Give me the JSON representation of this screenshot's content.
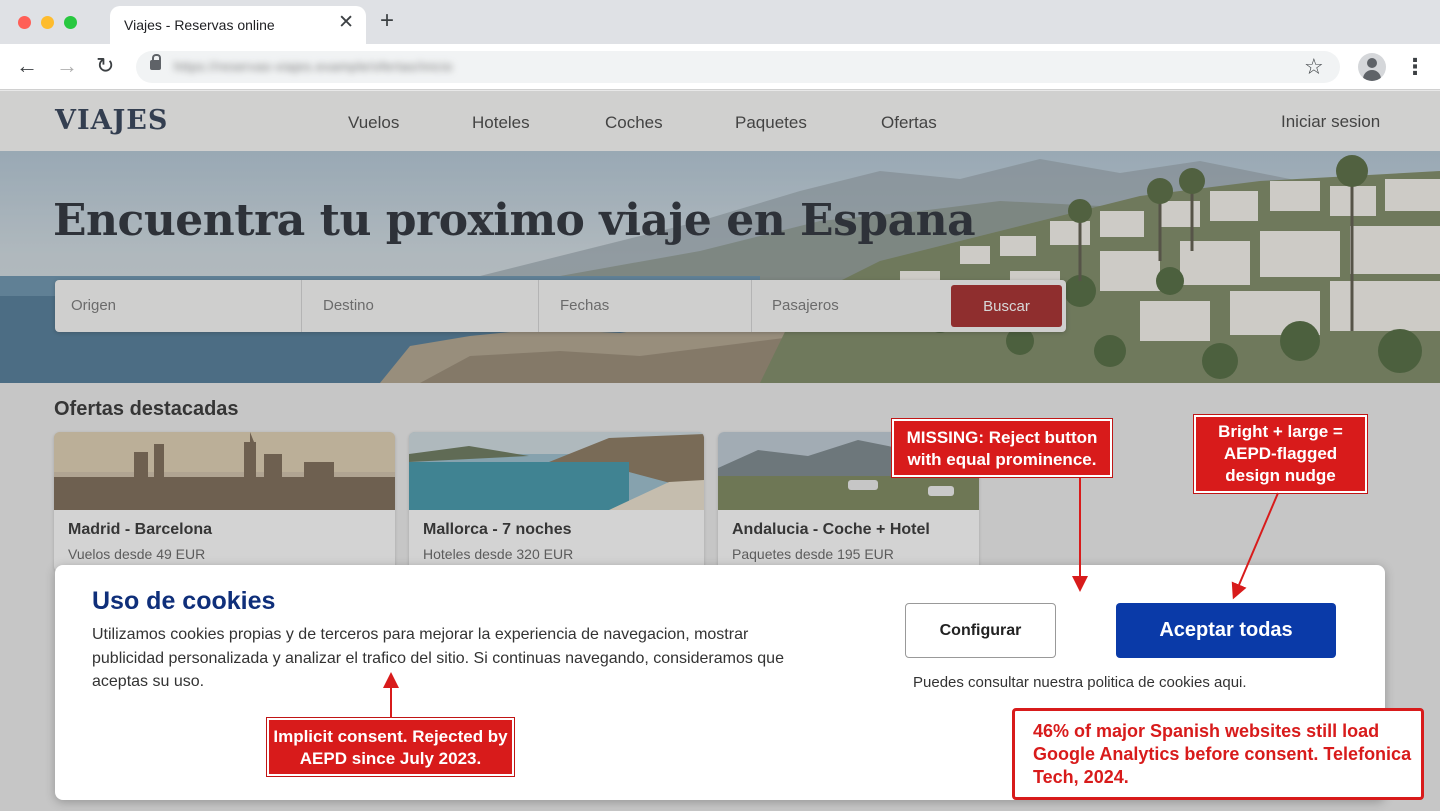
{
  "browser": {
    "tab_title": "Viajes - Reservas online",
    "tab_close": "✕",
    "new_tab": "+",
    "url": "https://reservas-viajes.example/ofertas/inicio"
  },
  "site": {
    "logo": "VIAJES",
    "nav": [
      "Vuelos",
      "Hoteles",
      "Coches",
      "Paquetes",
      "Ofertas"
    ],
    "login": "Iniciar sesion"
  },
  "hero": {
    "title": "Encuentra tu proximo viaje en Espana",
    "search": {
      "origen": "Origen",
      "destino": "Destino",
      "fechas": "Fechas",
      "pasajeros": "Pasajeros",
      "button": "Buscar"
    }
  },
  "offers": {
    "title": "Ofertas destacadas",
    "cards": [
      {
        "title": "Madrid - Barcelona",
        "subtitle": "Vuelos desde 49 EUR"
      },
      {
        "title": "Mallorca - 7 noches",
        "subtitle": "Hoteles desde 320 EUR"
      },
      {
        "title": "Andalucia - Coche + Hotel",
        "subtitle": "Paquetes desde 195 EUR"
      }
    ]
  },
  "cookie": {
    "title": "Uso de cookies",
    "text": "Utilizamos cookies propias y de terceros para mejorar la experiencia de navegacion, mostrar publicidad personalizada y analizar el trafico del sitio. Si continuas navegando, consideramos que aceptas su uso.",
    "configure": "Configurar",
    "accept": "Aceptar todas",
    "policy": "Puedes consultar nuestra politica de cookies aqui."
  },
  "annotations": {
    "missing": "MISSING: Reject button with equal prominence.",
    "bright": "Bright + large = AEPD-flagged design nudge",
    "implicit": "Implicit consent. Rejected by AEPD since July 2023.",
    "stat": "46% of major Spanish websites still load Google Analytics before consent. Telefonica Tech, 2024."
  },
  "colors": {
    "search_button": "#9b1515",
    "accept_button": "#0a3aa8",
    "cookie_title": "#0f2f7a",
    "annotation_red": "#d81b1b"
  },
  "icons": [
    "back-arrow-icon",
    "forward-arrow-icon",
    "reload-icon",
    "lock-icon",
    "star-icon",
    "profile-icon",
    "kebab-menu-icon",
    "close-icon",
    "plus-icon"
  ]
}
